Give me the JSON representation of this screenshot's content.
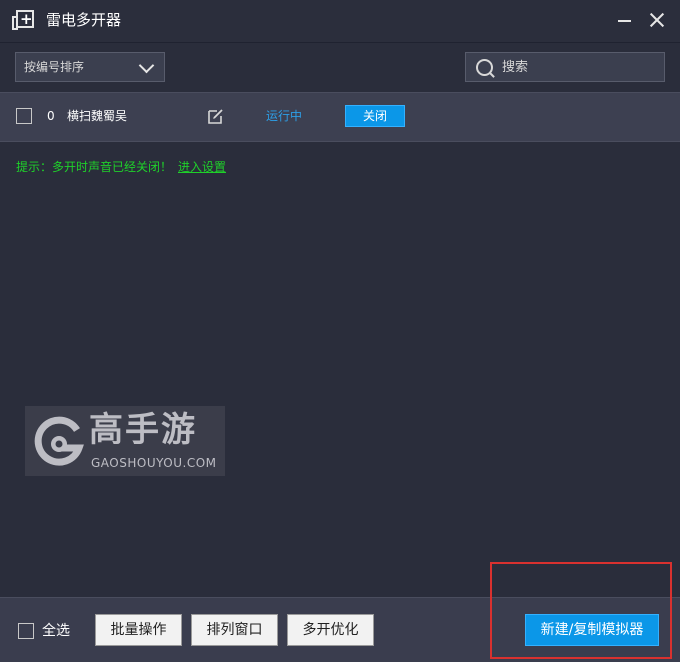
{
  "window": {
    "title": "雷电多开器",
    "icon": "add-window-icon"
  },
  "toolbar": {
    "sort_selected": "按编号排序",
    "search_placeholder": "搜索"
  },
  "emulators": [
    {
      "index": "0",
      "name": "横扫魏蜀吴",
      "status": "运行中",
      "action_label": "关闭",
      "checked": false
    }
  ],
  "tip": {
    "text": "提示：多开时声音已经关闭！",
    "link": "进入设置"
  },
  "watermark": {
    "text": "高手游",
    "sub": "GAOSHOUYOU.COM"
  },
  "bottom": {
    "select_all": "全选",
    "batch": "批量操作",
    "arrange": "排列窗口",
    "optimize": "多开优化",
    "new_copy": "新建/复制模拟器"
  },
  "colors": {
    "background": "#2a2d3b",
    "accent": "#0b97e8",
    "status": "#2d9ee6",
    "tip": "#1fd12a",
    "highlight": "#d9312f"
  }
}
